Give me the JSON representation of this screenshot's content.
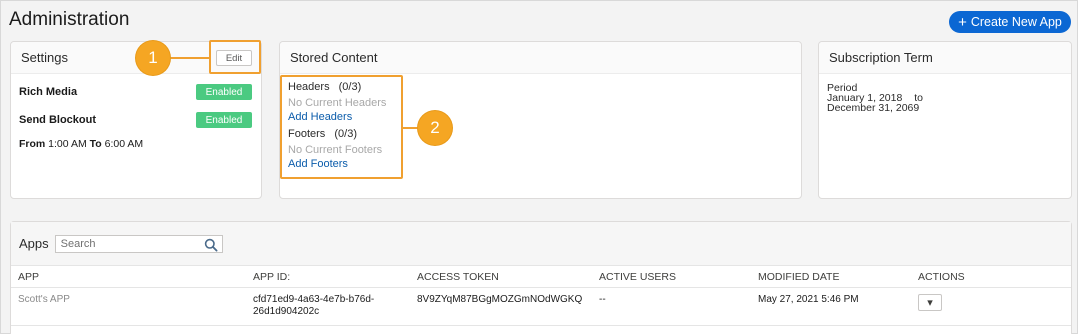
{
  "page": {
    "title": "Administration"
  },
  "header": {
    "create_button_label": "Create New App"
  },
  "settings": {
    "title": "Settings",
    "edit_label": "Edit",
    "rows": [
      {
        "label": "Rich Media",
        "status": "Enabled"
      },
      {
        "label": "Send Blockout",
        "status": "Enabled"
      }
    ],
    "schedule": {
      "from_label": "From",
      "from_time": "1:00 AM",
      "to_label": "To",
      "to_time": "6:00 AM"
    }
  },
  "stored_content": {
    "title": "Stored Content",
    "headers_label": "Headers",
    "headers_count": "(0/3)",
    "headers_empty": "No Current Headers",
    "add_headers": "Add Headers",
    "footers_label": "Footers",
    "footers_count": "(0/3)",
    "footers_empty": "No Current Footers",
    "add_footers": "Add Footers"
  },
  "subscription": {
    "title": "Subscription Term",
    "period_label": "Period",
    "start": "January 1, 2018",
    "to_word": "to",
    "end": "December 31, 2069"
  },
  "callouts": {
    "one": "1",
    "two": "2"
  },
  "apps": {
    "title": "Apps",
    "search_placeholder": "Search",
    "columns": [
      "APP",
      "APP ID:",
      "ACCESS TOKEN",
      "ACTIVE USERS",
      "MODIFIED DATE",
      "ACTIONS"
    ],
    "rows": [
      {
        "app": "Scott's APP",
        "app_id_line1": "cfd71ed9-4a63-4e7b-b76d-",
        "app_id_line2": "26d1d904202c",
        "access_token": "8V9ZYqM87BGgMOZGmNOdWGKQ",
        "active_users": "--",
        "modified_date": "May 27, 2021 5:46 PM",
        "action": "▾"
      }
    ]
  },
  "colors": {
    "brand_blue": "#0b67d3",
    "enabled_green": "#4bca81",
    "callout_orange": "#f5a623"
  }
}
